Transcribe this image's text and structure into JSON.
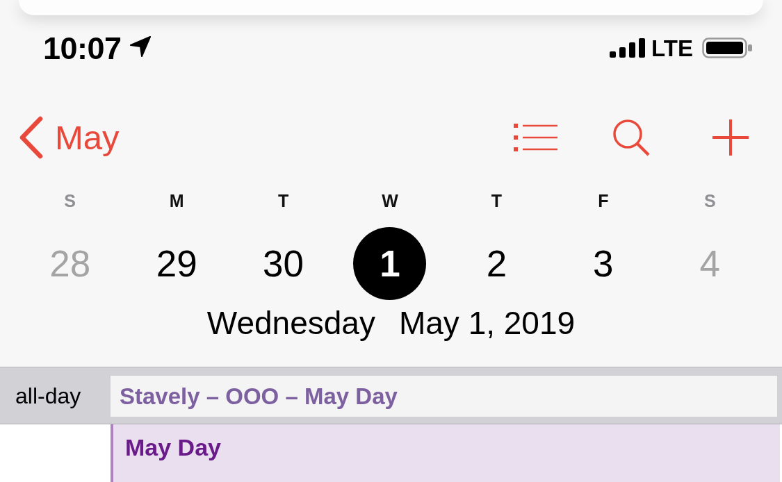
{
  "status_bar": {
    "time": "10:07",
    "network": "LTE"
  },
  "nav_bar": {
    "back_label": "May"
  },
  "week": [
    {
      "weekday": "S",
      "date": "28",
      "dimmed": true,
      "selected": false
    },
    {
      "weekday": "M",
      "date": "29",
      "dimmed": false,
      "selected": false
    },
    {
      "weekday": "T",
      "date": "30",
      "dimmed": false,
      "selected": false
    },
    {
      "weekday": "W",
      "date": "1",
      "dimmed": false,
      "selected": true
    },
    {
      "weekday": "T",
      "date": "2",
      "dimmed": false,
      "selected": false
    },
    {
      "weekday": "F",
      "date": "3",
      "dimmed": false,
      "selected": false
    },
    {
      "weekday": "S",
      "date": "4",
      "dimmed": true,
      "selected": false
    }
  ],
  "selected_day": {
    "weekday": "Wednesday",
    "date": "May 1, 2019"
  },
  "all_day": {
    "label": "all-day",
    "events": [
      {
        "title": "Stavely – OOO – May Day",
        "color": "#7d609f"
      }
    ]
  },
  "timeline": {
    "events": [
      {
        "title": "May Day",
        "color": "#6a1b8a"
      }
    ]
  }
}
